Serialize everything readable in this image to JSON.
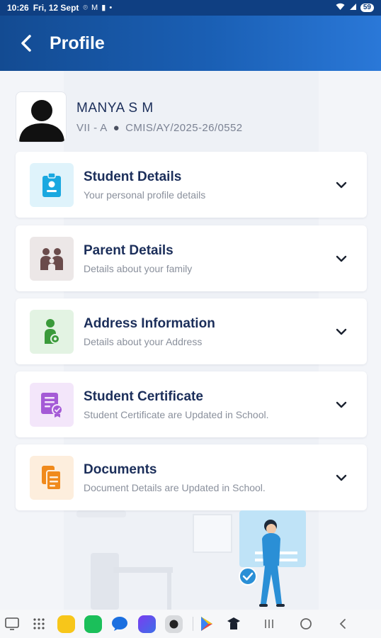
{
  "status_bar": {
    "time": "10:26",
    "date": "Fri, 12 Sept",
    "notif_icons": "⌾ M ▮ •",
    "battery": "59"
  },
  "header": {
    "title": "Profile"
  },
  "profile": {
    "name": "MANYA S M",
    "class": "VII - A",
    "admission_no": "CMIS/AY/2025-26/0552"
  },
  "sections": [
    {
      "title": "Student Details",
      "subtitle": "Your personal profile details",
      "icon": "id-badge-icon",
      "color": "#1aa8e0",
      "bg": "#dff3fb"
    },
    {
      "title": "Parent Details",
      "subtitle": "Details about your family",
      "icon": "family-icon",
      "color": "#6a4b4b",
      "bg": "#ece7e7"
    },
    {
      "title": "Address Information",
      "subtitle": "Details about your Address",
      "icon": "location-person-icon",
      "color": "#3a9a3a",
      "bg": "#e3f3e3"
    },
    {
      "title": "Student Certificate",
      "subtitle": "Student Certificate are Updated in School.",
      "icon": "certificate-icon",
      "color": "#a45ad6",
      "bg": "#f3e6fa"
    },
    {
      "title": "Documents",
      "subtitle": "Document Details are Updated in School.",
      "icon": "documents-icon",
      "color": "#f08a1c",
      "bg": "#fdeedd"
    }
  ],
  "colors": {
    "header_start": "#134b92",
    "header_end": "#2a78d8",
    "title_text": "#1b2e5a"
  }
}
